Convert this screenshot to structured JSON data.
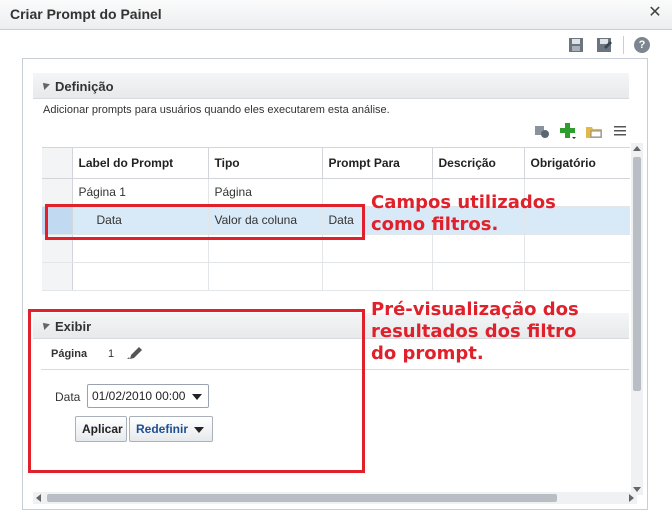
{
  "window": {
    "title": "Criar Prompt do Painel",
    "close_glyph": "✕"
  },
  "toolbar": {
    "icons": [
      "save-icon",
      "save-as-icon"
    ],
    "help_glyph": "?"
  },
  "definicao": {
    "title": "Definição",
    "description": "Adicionar prompts para usuários quando eles executarem esta análise.",
    "tools": [
      "filter-prompt-icon",
      "add-icon",
      "folder-icon",
      "more-icon"
    ],
    "columns": [
      "Label do Prompt",
      "Tipo",
      "Prompt Para",
      "Descrição",
      "Obrigatório"
    ],
    "rows": [
      {
        "label": "Página 1",
        "tipo": "Página",
        "prompt_para": "",
        "descricao": "",
        "obrigatorio": ""
      },
      {
        "label": "Data",
        "tipo": "Valor da coluna",
        "prompt_para": "Data",
        "descricao": "",
        "obrigatorio": ""
      }
    ]
  },
  "exibir": {
    "title": "Exibir",
    "page_label": "Página",
    "page_value": "1",
    "date_label": "Data",
    "date_value": "01/02/2010 00:00",
    "apply_label": "Aplicar",
    "reset_label": "Redefinir"
  },
  "annotations": {
    "filters_note": [
      "Campos utilizados",
      "como filtros."
    ],
    "preview_note": [
      "Pré-visualização dos",
      "resultados dos filtro",
      "do prompt."
    ],
    "color": "#e0202a"
  },
  "colors": {
    "selected_row": "#d8e9f8",
    "link_blue": "#1d4f91",
    "accent_red": "#e0202a"
  }
}
